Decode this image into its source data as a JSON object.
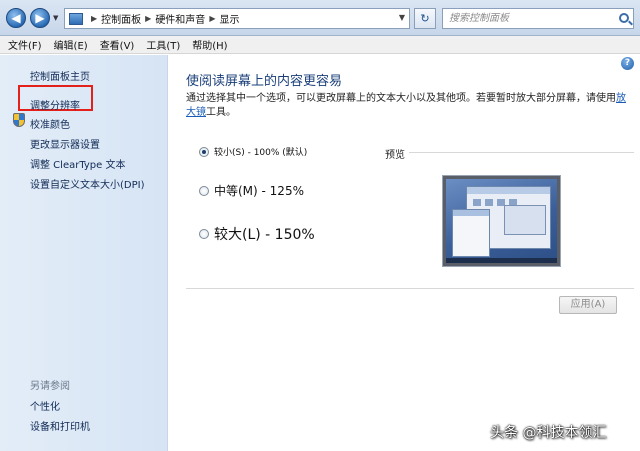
{
  "address_bar": {
    "back_glyph": "◀",
    "forward_glyph": "▶",
    "breadcrumbs": [
      "控制面板",
      "硬件和声音",
      "显示"
    ],
    "search_placeholder": "搜索控制面板",
    "refresh_glyph": "↻"
  },
  "menu": [
    "文件(F)",
    "编辑(E)",
    "查看(V)",
    "工具(T)",
    "帮助(H)"
  ],
  "sidebar": {
    "home": "控制面板主页",
    "links": [
      "调整分辨率",
      "校准颜色",
      "更改显示器设置",
      "调整 ClearType 文本",
      "设置自定义文本大小(DPI)"
    ],
    "see_also_title": "另请参阅",
    "see_also": [
      "个性化",
      "设备和打印机"
    ],
    "highlight_color": "#e3201a"
  },
  "main": {
    "help_glyph": "?",
    "title": "使阅读屏幕上的内容更容易",
    "desc_text": "通过选择其中一个选项，可以更改屏幕上的文本大小以及其他项。若要暂时放大部分屏幕，请使用",
    "desc_link": "放大镜",
    "desc_suffix": "工具。",
    "options": [
      {
        "label": "较小(S) - 100% (默认)",
        "checked": true
      },
      {
        "label": "中等(M) - 125%",
        "checked": false
      },
      {
        "label": "较大(L) - 150%",
        "checked": false
      }
    ],
    "preview_label": "预览",
    "apply_button": "应用(A)"
  },
  "watermark": "头条 @科技本领汇"
}
